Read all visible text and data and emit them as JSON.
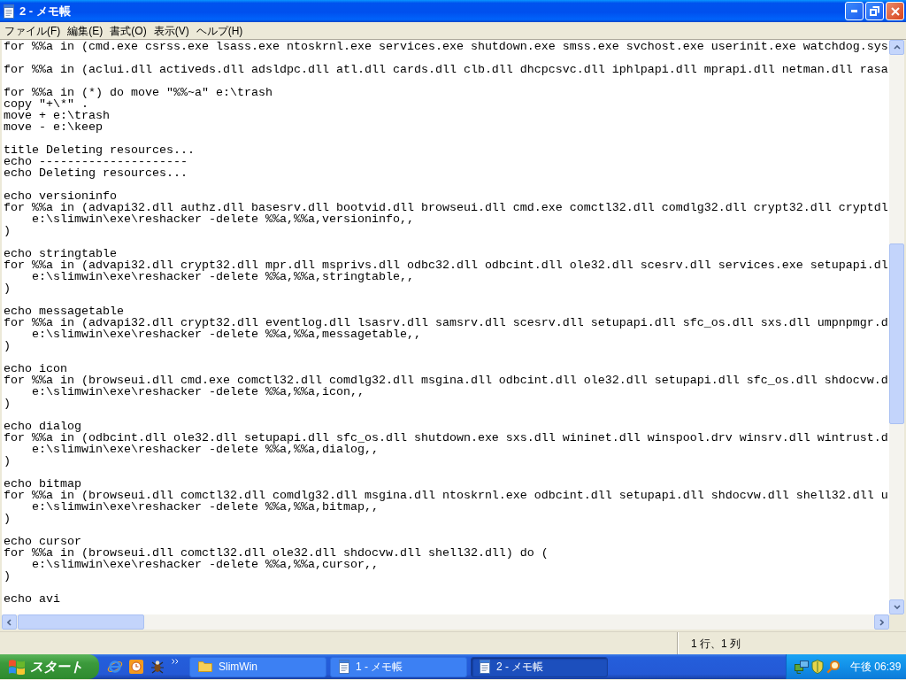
{
  "window": {
    "title": "2 - メモ帳"
  },
  "menu": [
    "ファイル(F)",
    "編集(E)",
    "書式(O)",
    "表示(V)",
    "ヘルプ(H)"
  ],
  "editor": {
    "blocks": [
      [
        "for %%a in (cmd.exe csrss.exe lsass.exe ntoskrnl.exe services.exe shutdown.exe smss.exe svchost.exe userinit.exe watchdog.sys"
      ],
      [
        "for %%a in (aclui.dll activeds.dll adsldpc.dll atl.dll cards.dll clb.dll dhcpcsvc.dll iphlpapi.dll mprapi.dll netman.dll rasa"
      ],
      [
        "for %%a in (*) do move \"%%~a\" e:\\trash",
        "copy \"+\\*\" .",
        "move + e:\\trash",
        "move - e:\\keep"
      ],
      [
        "title Deleting resources...",
        "echo ---------------------",
        "echo Deleting resources..."
      ],
      [
        "echo versioninfo",
        "for %%a in (advapi32.dll authz.dll basesrv.dll bootvid.dll browseui.dll cmd.exe comctl32.dll comdlg32.dll crypt32.dll cryptdl",
        "\te:\\slimwin\\exe\\reshacker -delete %%a,%%a,versioninfo,,",
        ")"
      ],
      [
        "echo stringtable",
        "for %%a in (advapi32.dll crypt32.dll mpr.dll msprivs.dll odbc32.dll odbcint.dll ole32.dll scesrv.dll services.exe setupapi.dl",
        "\te:\\slimwin\\exe\\reshacker -delete %%a,%%a,stringtable,,",
        ")"
      ],
      [
        "echo messagetable",
        "for %%a in (advapi32.dll crypt32.dll eventlog.dll lsasrv.dll samsrv.dll scesrv.dll setupapi.dll sfc_os.dll sxs.dll umpnpmgr.d",
        "\te:\\slimwin\\exe\\reshacker -delete %%a,%%a,messagetable,,",
        ")"
      ],
      [
        "echo icon",
        "for %%a in (browseui.dll cmd.exe comctl32.dll comdlg32.dll msgina.dll odbcint.dll ole32.dll setupapi.dll sfc_os.dll shdocvw.d",
        "\te:\\slimwin\\exe\\reshacker -delete %%a,%%a,icon,,",
        ")"
      ],
      [
        "echo dialog",
        "for %%a in (odbcint.dll ole32.dll setupapi.dll sfc_os.dll shutdown.exe sxs.dll wininet.dll winspool.drv winsrv.dll wintrust.d",
        "\te:\\slimwin\\exe\\reshacker -delete %%a,%%a,dialog,,",
        ")"
      ],
      [
        "echo bitmap",
        "for %%a in (browseui.dll comctl32.dll comdlg32.dll msgina.dll ntoskrnl.exe odbcint.dll setupapi.dll shdocvw.dll shell32.dll u",
        "\te:\\slimwin\\exe\\reshacker -delete %%a,%%a,bitmap,,",
        ")"
      ],
      [
        "echo cursor",
        "for %%a in (browseui.dll comctl32.dll ole32.dll shdocvw.dll shell32.dll) do (",
        "\te:\\slimwin\\exe\\reshacker -delete %%a,%%a,cursor,,",
        ")"
      ],
      [
        "echo avi"
      ]
    ]
  },
  "status_bar": {
    "position": "1 行、1 列"
  },
  "taskbar": {
    "start_label": "スタート",
    "tasks": [
      {
        "label": "SlimWin",
        "kind": "folder",
        "selected": false
      },
      {
        "label": "1 - メモ帳",
        "kind": "notepad",
        "selected": false
      },
      {
        "label": "2 - メモ帳",
        "kind": "notepad",
        "selected": true
      }
    ],
    "clock": "午後 06:39"
  }
}
